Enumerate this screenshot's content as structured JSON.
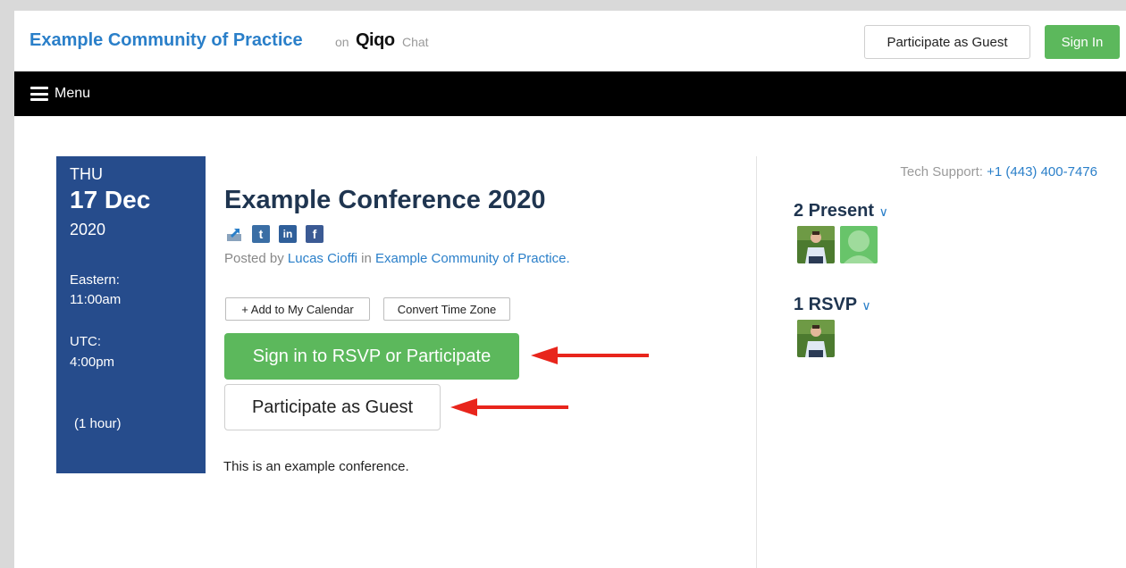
{
  "header": {
    "brand": "Example Community of Practice",
    "on_label": "on",
    "platform_logo": "Qiqo",
    "platform_suffix": "Chat",
    "guest_button": "Participate as Guest",
    "signin_button": "Sign In"
  },
  "nav": {
    "menu_label": "Menu",
    "menu_icon": "hamburger-icon"
  },
  "event": {
    "day_of_week": "THU",
    "date": "17 Dec",
    "year": "2020",
    "tz_eastern": "Eastern:",
    "time_eastern": "11:00am",
    "tz_utc": "UTC:",
    "time_utc": "4:00pm",
    "duration": "(1 hour)",
    "title": "Example Conference 2020",
    "posted_prefix": "Posted by",
    "author": "Lucas Cioffi",
    "posted_in": "in",
    "community": "Example Community of Practice",
    "posted_suffix": ".",
    "add_calendar_button": "+ Add to My Calendar",
    "convert_tz_button": "Convert Time Zone",
    "rsvp_button": "Sign in to RSVP or Participate",
    "guest_button": "Participate as Guest",
    "description": "This is an example conference.",
    "share_icons": [
      "share-icon",
      "twitter-icon",
      "linkedin-icon",
      "facebook-icon"
    ]
  },
  "sidebar": {
    "support_label": "Tech Support:",
    "support_phone": "+1 (443) 400-7476",
    "present_heading": "2 Present",
    "rsvp_heading": "1 RSVP",
    "chevron": "»"
  },
  "colors": {
    "brand_blue": "#2a7fc9",
    "navy": "#1f3550",
    "date_block": "#264c8c",
    "green": "#5cb85c",
    "arrow_red": "#e8251c"
  }
}
